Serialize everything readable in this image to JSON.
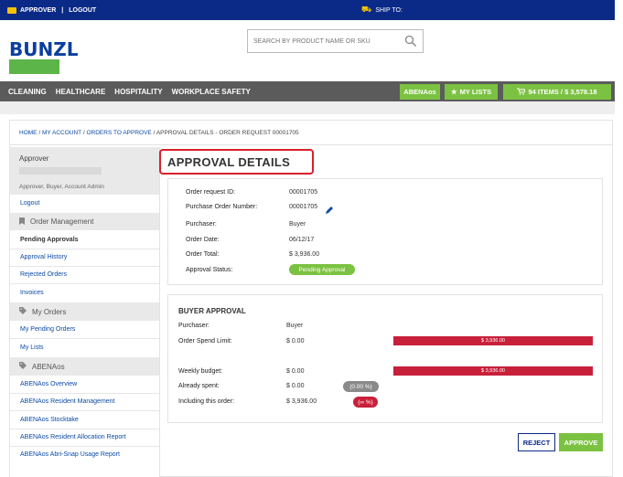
{
  "topbar": {
    "approver": "APPROVER",
    "separator": "|",
    "logout": "LOGOUT",
    "ship_to": "SHIP TO:"
  },
  "logo": {
    "text": "BUNZL"
  },
  "search": {
    "placeholder": "SEARCH BY PRODUCT NAME OR SKU"
  },
  "nav": {
    "items": [
      "CLEANING",
      "HEALTHCARE",
      "HOSPITALITY",
      "WORKPLACE SAFETY"
    ],
    "account": "ABENAos",
    "lists": "MY LISTS",
    "cart": "94 ITEMS / $ 3,578.18"
  },
  "breadcrumb": {
    "home": "HOME",
    "account": "MY ACCOUNT",
    "orders": "ORDERS TO APPROVE",
    "current": "APPROVAL DETAILS - ORDER REQUEST 00001705",
    "sep": "/"
  },
  "sidebar": {
    "user_title": "Approver",
    "roles": "Approver, Buyer, Account Admin",
    "logout": "Logout",
    "order_mgmt_header": "Order Management",
    "order_links": [
      "Pending Approvals",
      "Approval History",
      "Rejected Orders",
      "Invoices"
    ],
    "my_orders_header": "My Orders",
    "my_orders_links": [
      "My Pending Orders",
      "My Lists"
    ],
    "abenaos_header": "ABENAos",
    "abenaos_links": [
      "ABENAos Overview",
      "ABENAos Resident Management",
      "ABENAos Stocktake",
      "ABENAos Resident Allocation Report",
      "ABENAos Abri-Snap Usage Report"
    ]
  },
  "page_title": "APPROVAL DETAILS",
  "details": {
    "order_request_id_label": "Order request ID:",
    "order_request_id": "00001705",
    "po_label": "Purchase Order Number:",
    "po_value": "00001705",
    "purchaser_label": "Purchaser:",
    "purchaser": "Buyer",
    "order_date_label": "Order Date:",
    "order_date": "06/12/17",
    "order_total_label": "Order Total:",
    "order_total": "$ 3,936.00",
    "status_label": "Approval Status:",
    "status": "Pending Approval"
  },
  "buyer_approval": {
    "title": "BUYER APPROVAL",
    "purchaser_label": "Purchaser:",
    "purchaser": "Buyer",
    "spend_limit_label": "Order Spend Limit:",
    "spend_limit": "$ 0.00",
    "spend_bar": "$ 3,936.00",
    "weekly_budget_label": "Weekly budget:",
    "weekly_budget": "$ 0.00",
    "weekly_bar": "$ 3,936.00",
    "already_spent_label": "Already spent:",
    "already_spent": "$ 0.00",
    "already_spent_pct": "(0.00 %)",
    "including_label": "Including this order:",
    "including": "$ 3,936.00",
    "including_pct": "(∞ %)"
  },
  "actions": {
    "reject": "REJECT",
    "approve": "APPROVE"
  },
  "colors": {
    "navy": "#0b2a87",
    "green": "#7cc242",
    "red": "#c8203a",
    "nav_gray": "#5b5b5b"
  }
}
